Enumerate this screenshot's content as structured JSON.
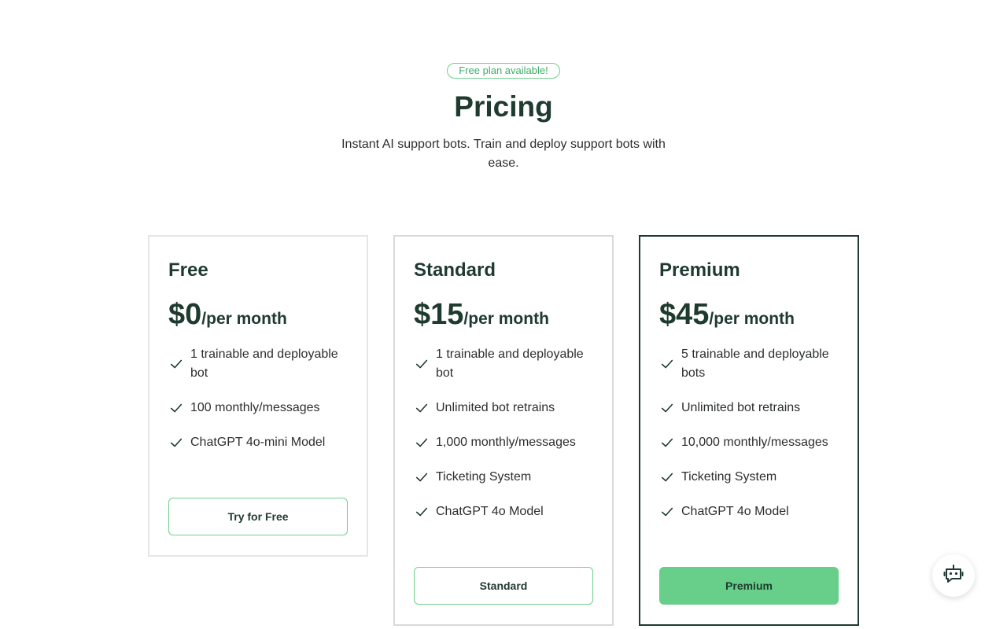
{
  "header": {
    "badge": "Free plan available!",
    "title": "Pricing",
    "subtitle": "Instant AI support bots. Train and deploy support bots with ease."
  },
  "plans": [
    {
      "name": "Free",
      "price": "$0",
      "period": "/per month",
      "features": [
        "1 trainable and deployable bot",
        "100 monthly/messages",
        "ChatGPT 4o-mini Model"
      ],
      "cta": "Try for Free"
    },
    {
      "name": "Standard",
      "price": "$15",
      "period": "/per month",
      "features": [
        "1 trainable and deployable bot",
        "Unlimited bot retrains",
        "1,000 monthly/messages",
        "Ticketing System",
        "ChatGPT 4o Model"
      ],
      "cta": "Standard"
    },
    {
      "name": "Premium",
      "price": "$45",
      "period": "/per month",
      "features": [
        "5 trainable and deployable bots",
        "Unlimited bot retrains",
        "10,000 monthly/messages",
        "Ticketing System",
        "ChatGPT 4o Model"
      ],
      "cta": "Premium"
    }
  ],
  "icons": {
    "feature": "check-icon",
    "chat": "bot-chat-icon"
  },
  "colors": {
    "accent": "#67cf8a",
    "text": "#1f3a2e"
  }
}
